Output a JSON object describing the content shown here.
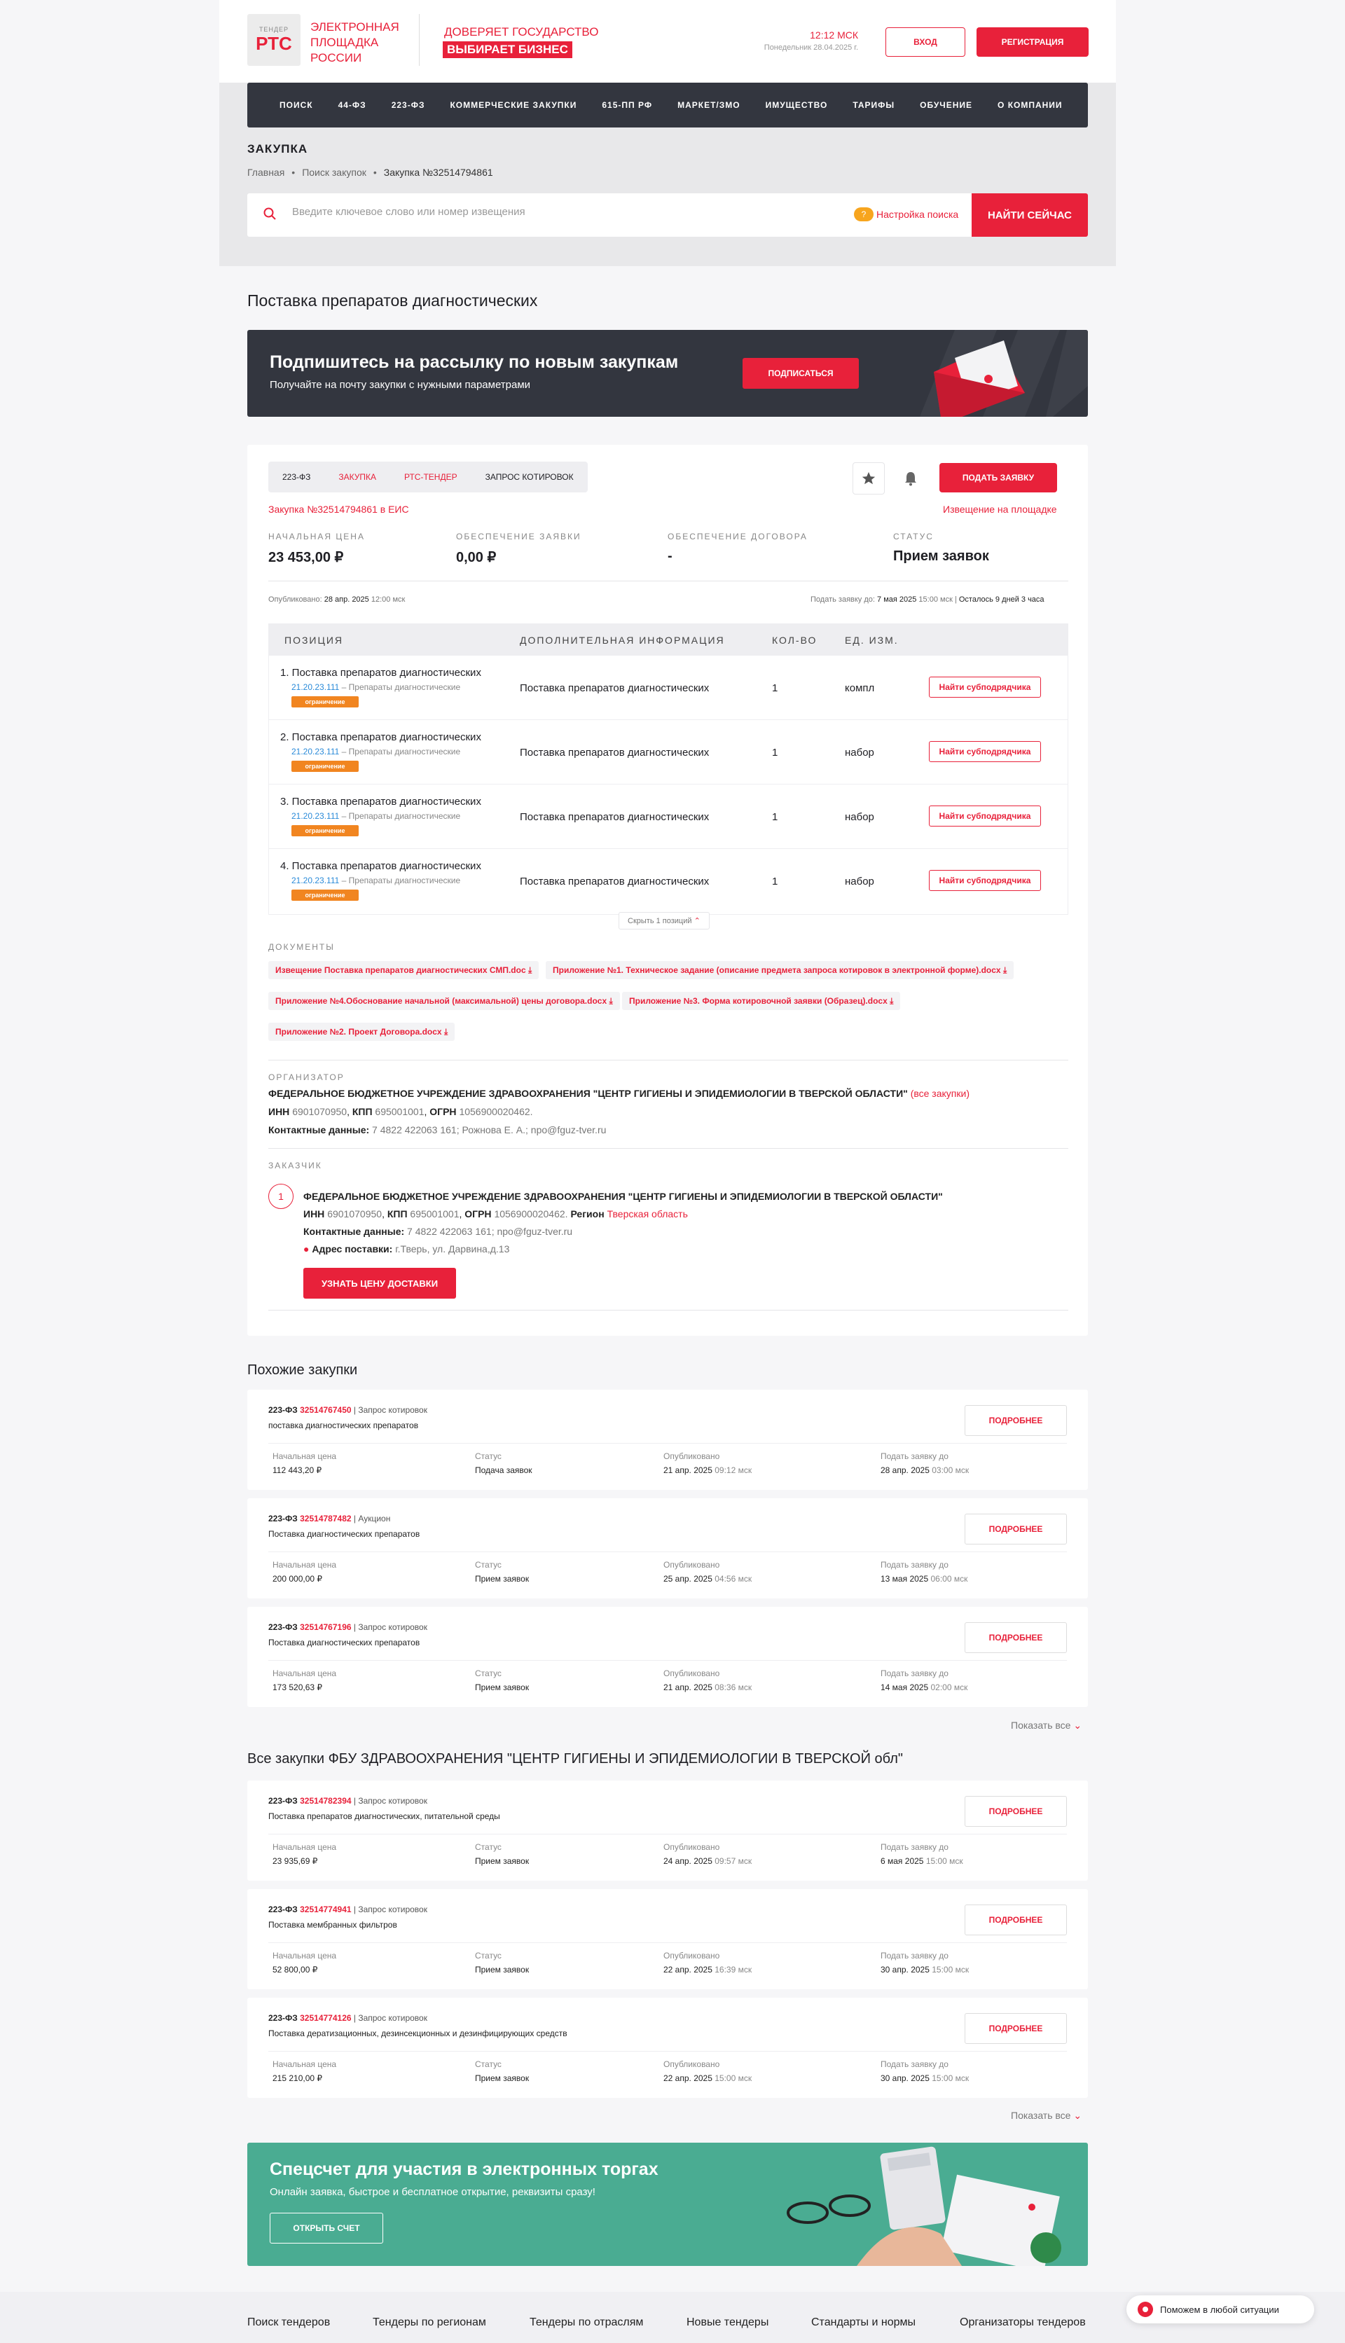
{
  "header": {
    "logo_small": "ТЕНДЕР",
    "logo_big": "РТС",
    "logo_text": "ЭЛЕКТРОННАЯ ПЛОЩАДКА РОССИИ",
    "slogan_1": "ДОВЕРЯЕТ ГОСУДАРСТВО",
    "slogan_2": "ВЫБИРАЕТ БИЗНЕС",
    "time": "12:12 МСК",
    "date": "Понедельник 28.04.2025 г.",
    "login": "ВХОД",
    "register": "РЕГИСТРАЦИЯ"
  },
  "nav": [
    "ПОИСК",
    "44-ФЗ",
    "223-ФЗ",
    "КОММЕРЧЕСКИЕ ЗАКУПКИ",
    "615-ПП РФ",
    "МАРКЕТ/ЗМО",
    "ИМУЩЕСТВО",
    "ТАРИФЫ",
    "ОБУЧЕНИЕ",
    "О КОМПАНИИ"
  ],
  "section_title": "ЗАКУПКА",
  "breadcrumbs": [
    "Главная",
    "Поиск закупок",
    "Закупка №32514794861"
  ],
  "search": {
    "placeholder": "Введите ключевое слово или номер извещения",
    "badge": "?",
    "settings": "Настройка поиска",
    "button": "НАЙТИ СЕЙЧАС"
  },
  "page_title": "Поставка препаратов диагностических",
  "subscribe": {
    "title": "Подпишитесь на рассылку по новым закупкам",
    "desc": "Получайте на почту закупки с нужными параметрами",
    "button": "ПОДПИСАТЬСЯ"
  },
  "tender": {
    "tabs": [
      "223-ФЗ",
      "ЗАКУПКА",
      "РТС-ТЕНДЕР",
      "ЗАПРОС КОТИРОВОК"
    ],
    "apply": "ПОДАТЬ ЗАЯВКУ",
    "eis_link": "Закупка №32514794861 в ЕИС",
    "notice_link": "Извещение на площадке",
    "stats": [
      {
        "label": "НАЧАЛЬНАЯ ЦЕНА",
        "value": "23 453,00 ₽"
      },
      {
        "label": "ОБЕСПЕЧЕНИЕ ЗАЯВКИ",
        "value": "0,00 ₽"
      },
      {
        "label": "ОБЕСПЕЧЕНИЕ ДОГОВОРА",
        "value": "-"
      },
      {
        "label": "СТАТУС",
        "value": "Прием заявок"
      }
    ],
    "published_label": "Опубликовано:",
    "published_date": "28 апр. 2025",
    "published_time": "12:00 мск",
    "deadline_label": "Подать заявку до:",
    "deadline_date": "7 мая 2025",
    "deadline_time": "15:00 мск",
    "remaining": "Осталось 9 дней 3 часа"
  },
  "positions": {
    "headers": [
      "ПОЗИЦИЯ",
      "ДОПОЛНИТЕЛЬНАЯ ИНФОРМАЦИЯ",
      "КОЛ-ВО",
      "ЕД. ИЗМ."
    ],
    "rows": [
      {
        "name": "1. Поставка препаратов диагностических",
        "code": "21.20.23.111",
        "code_desc": "– Препараты диагностические",
        "tag": "ограничение",
        "info": "Поставка препаратов диагностических",
        "qty": "1",
        "unit": "компл",
        "btn": "Найти субподрядчика"
      },
      {
        "name": "2. Поставка препаратов диагностических",
        "code": "21.20.23.111",
        "code_desc": "– Препараты диагностические",
        "tag": "ограничение",
        "info": "Поставка препаратов диагностических",
        "qty": "1",
        "unit": "набор",
        "btn": "Найти субподрядчика"
      },
      {
        "name": "3. Поставка препаратов диагностических",
        "code": "21.20.23.111",
        "code_desc": "– Препараты диагностические",
        "tag": "ограничение",
        "info": "Поставка препаратов диагностических",
        "qty": "1",
        "unit": "набор",
        "btn": "Найти субподрядчика"
      },
      {
        "name": "4. Поставка препаратов диагностических",
        "code": "21.20.23.111",
        "code_desc": "– Препараты диагностические",
        "tag": "ограничение",
        "info": "Поставка препаратов диагностических",
        "qty": "1",
        "unit": "набор",
        "btn": "Найти субподрядчика"
      }
    ],
    "hide": "Скрыть 1 позиций"
  },
  "documents": {
    "label": "ДОКУМЕНТЫ",
    "items": [
      "Извещение Поставка препаратов диагностических СМП.doc",
      "Приложение №1. Техническое задание (описание предмета запроса котировок в электронной форме).docx",
      "Приложение №4.Обоснование начальной (максимальной) цены договора.docx",
      "Приложение №3. Форма котировочной заявки (Образец).docx",
      "Приложение №2. Проект Договора.docx"
    ]
  },
  "organizer": {
    "label": "ОРГАНИЗАТОР",
    "name": "ФЕДЕРАЛЬНОЕ БЮДЖЕТНОЕ УЧРЕЖДЕНИЕ ЗДРАВООХРАНЕНИЯ \"ЦЕНТР ГИГИЕНЫ И ЭПИДЕМИОЛОГИИ В ТВЕРСКОЙ ОБЛАСТИ\"",
    "all": "(все закупки)",
    "inn_l": "ИНН",
    "inn": "6901070950",
    "kpp_l": "КПП",
    "kpp": "695001001",
    "ogrn_l": "ОГРН",
    "ogrn": "1056900020462.",
    "contacts_l": "Контактные данные:",
    "contacts": "7 4822 422063 161; Рожнова Е. А.; npo@fguz-tver.ru"
  },
  "customer": {
    "label": "ЗАКАЗЧИК",
    "num": "1",
    "name": "ФЕДЕРАЛЬНОЕ БЮДЖЕТНОЕ УЧРЕЖДЕНИЕ ЗДРАВООХРАНЕНИЯ \"ЦЕНТР ГИГИЕНЫ И ЭПИДЕМИОЛОГИИ В ТВЕРСКОЙ ОБЛАСТИ\"",
    "inn_l": "ИНН",
    "inn": "6901070950",
    "kpp_l": "КПП",
    "kpp": "695001001",
    "ogrn_l": "ОГРН",
    "ogrn": "1056900020462.",
    "region_l": "Регион",
    "region": "Тверская область",
    "contacts_l": "Контактные данные:",
    "contacts": "7 4822 422063 161; npo@fguz-tver.ru",
    "addr_l": "Адрес поставки:",
    "addr": "г.Тверь, ул. Дарвина,д.13",
    "delivery_btn": "УЗНАТЬ ЦЕНУ ДОСТАВКИ"
  },
  "similar": {
    "title": "Похожие закупки",
    "show_all": "Показать все",
    "cols": [
      "Начальная цена",
      "Статус",
      "Опубликовано",
      "Подать заявку до"
    ],
    "more": "ПОДРОБНЕЕ",
    "items": [
      {
        "law": "223-ФЗ",
        "num": "32514767450",
        "type": "| Запрос котировок",
        "name": "поставка диагностических препаратов",
        "price": "112 443,20 ₽",
        "status": "Подача заявок",
        "pub": "21 апр. 2025",
        "pub_t": "09:12 мск",
        "dl": "28 апр. 2025",
        "dl_t": "03:00 мск"
      },
      {
        "law": "223-ФЗ",
        "num": "32514787482",
        "type": "| Аукцион",
        "name": "Поставка диагностических препаратов",
        "price": "200 000,00 ₽",
        "status": "Прием заявок",
        "pub": "25 апр. 2025",
        "pub_t": "04:56 мск",
        "dl": "13 мая 2025",
        "dl_t": "06:00 мск"
      },
      {
        "law": "223-ФЗ",
        "num": "32514767196",
        "type": "| Запрос котировок",
        "name": "Поставка диагностических препаратов",
        "price": "173 520,63 ₽",
        "status": "Прием заявок",
        "pub": "21 апр. 2025",
        "pub_t": "08:36 мск",
        "dl": "14 мая 2025",
        "dl_t": "02:00 мск"
      }
    ]
  },
  "all_purchases": {
    "title": "Все закупки ФБУ ЗДРАВООХРАНЕНИЯ \"ЦЕНТР ГИГИЕНЫ И ЭПИДЕМИОЛОГИИ В ТВЕРСКОЙ обл\"",
    "show_all": "Показать все",
    "items": [
      {
        "law": "223-ФЗ",
        "num": "32514782394",
        "type": "| Запрос котировок",
        "name": "Поставка препаратов диагностических, питательной среды",
        "price": "23 935,69 ₽",
        "status": "Прием заявок",
        "pub": "24 апр. 2025",
        "pub_t": "09:57 мск",
        "dl": "6 мая 2025",
        "dl_t": "15:00 мск"
      },
      {
        "law": "223-ФЗ",
        "num": "32514774941",
        "type": "| Запрос котировок",
        "name": "Поставка мембранных фильтров",
        "price": "52 800,00 ₽",
        "status": "Прием заявок",
        "pub": "22 апр. 2025",
        "pub_t": "16:39 мск",
        "dl": "30 апр. 2025",
        "dl_t": "15:00 мск"
      },
      {
        "law": "223-ФЗ",
        "num": "32514774126",
        "type": "| Запрос котировок",
        "name": "Поставка дератизационных, дезинсекционных и дезинфицирующих средств",
        "price": "215 210,00 ₽",
        "status": "Прием заявок",
        "pub": "22 апр. 2025",
        "pub_t": "15:00 мск",
        "dl": "30 апр. 2025",
        "dl_t": "15:00 мск"
      }
    ]
  },
  "promo": {
    "title": "Спецсчет для участия в электронных торгах",
    "desc": "Онлайн заявка, быстрое и бесплатное открытие, реквизиты сразу!",
    "button": "ОТКРЫТЬ СЧЕТ"
  },
  "footer": [
    "Поиск тендеров",
    "Тендеры по регионам",
    "Тендеры по отраслям",
    "Новые тендеры",
    "Стандарты и нормы",
    "Организаторы тендеров"
  ],
  "help": "Поможем в любой ситуации"
}
